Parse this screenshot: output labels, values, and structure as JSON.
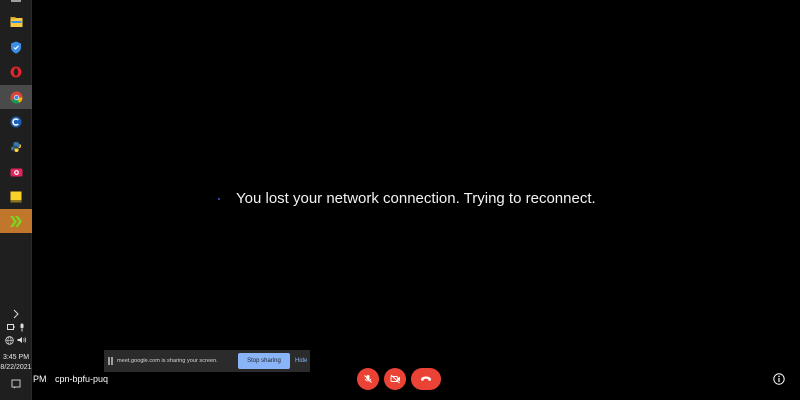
{
  "taskbar": {
    "apps": [
      {
        "icon": "file-explorer-icon",
        "name": "File Explorer"
      },
      {
        "icon": "shield-icon",
        "name": "Security"
      },
      {
        "icon": "opera-icon",
        "name": "Opera"
      },
      {
        "icon": "chrome-icon",
        "name": "Google Chrome"
      },
      {
        "icon": "ccleaner-icon",
        "name": "CCleaner"
      },
      {
        "icon": "python-icon",
        "name": "Python"
      },
      {
        "icon": "camera-app-icon",
        "name": "Recorder"
      },
      {
        "icon": "sticky-notes-icon",
        "name": "Sticky Notes"
      },
      {
        "icon": "green-arrows-app-icon",
        "name": "App"
      }
    ],
    "clock": {
      "time": "3:45 PM",
      "date": "8/22/2021"
    }
  },
  "meeting": {
    "status_message": "You lost your network connection. Trying to reconnect.",
    "time_fragment": "PM",
    "meeting_code": "cpn-bpfu-puq"
  },
  "share_banner": {
    "text": "meet.google.com is sharing your screen.",
    "stop_label": "Stop sharing",
    "hide_label": "Hide"
  },
  "controls": {
    "mic_state": "off",
    "camera_state": "off",
    "accent_red": "#ea4335"
  },
  "colors": {
    "background": "#000000",
    "taskbar": "#1f1f1f",
    "link_blue": "#8ab4f8"
  }
}
